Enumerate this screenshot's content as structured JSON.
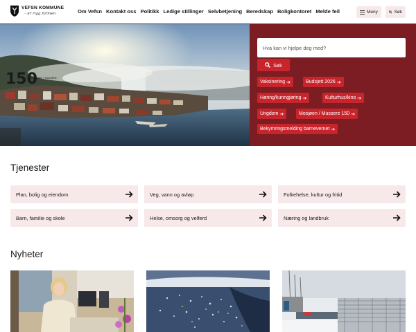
{
  "header": {
    "logo_name": "VEFSN KOMMUNE",
    "logo_motto": "– er rigg formen",
    "nav": [
      "Om Vefsn",
      "Kontakt oss",
      "Politikk",
      "Ledige stillinger",
      "Selvbetjening",
      "Beredskap",
      "Boligkontoret",
      "Melde feil"
    ],
    "menu_label": "Meny",
    "search_label": "Søk"
  },
  "hero": {
    "overlay_number": "150",
    "overlay_text": "MOSJØEN / MUSSERE",
    "search_placeholder": "Hva kan vi hjelpe deg med?",
    "search_button": "Søk",
    "tags": [
      "Vaksinering",
      "Budsjett 2026",
      "Høring/kunngjøring",
      "Kulturhus/kino",
      "Ungdom",
      "Mosjøen / Mussere 150",
      "Bekymringsmelding barnevernet"
    ]
  },
  "services": {
    "title": "Tjenester",
    "items": [
      "Plan, bolig og eiendom",
      "Veg, vann og avløp",
      "Folkehelse, kultur og fritid",
      "Barn, familie og skole",
      "Helse, omsorg og velferd",
      "Næring og landbruk"
    ]
  },
  "news": {
    "title": "Nyheter"
  },
  "colors": {
    "brand_dark": "#7b1d22",
    "brand_red": "#c8242c",
    "card_bg": "#f7e9e9"
  }
}
